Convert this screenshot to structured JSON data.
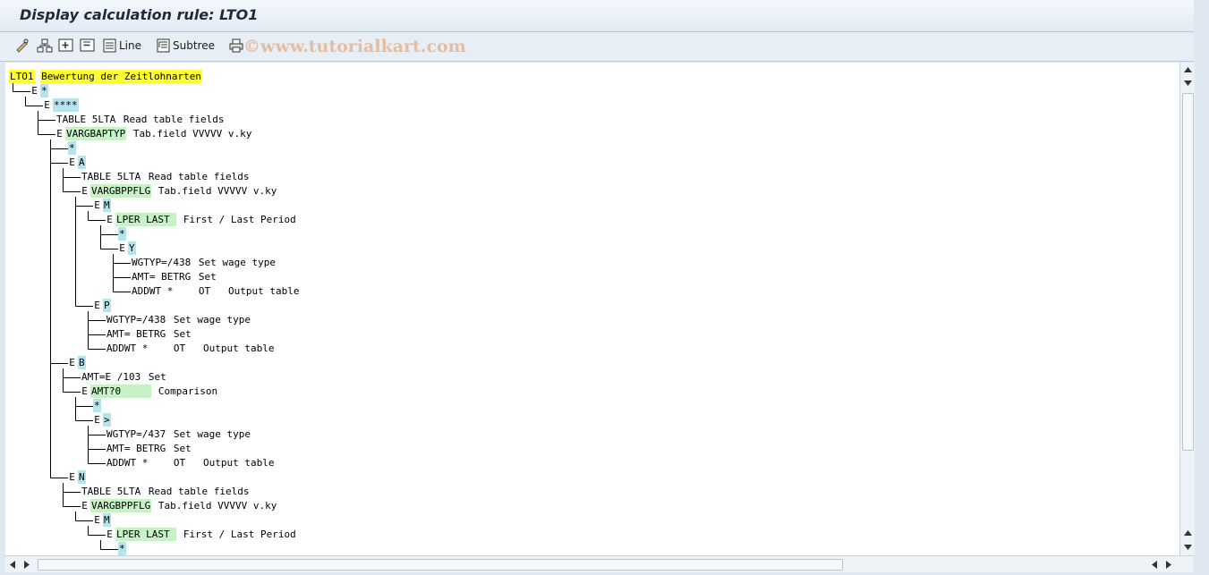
{
  "window": {
    "title": "Display calculation rule: LTO1"
  },
  "toolbar": {
    "line_label": "Line",
    "subtree_label": "Subtree",
    "watermark": "©www.tutorialkart.com"
  },
  "tree_rows": [
    {
      "depth": 0,
      "marker": "",
      "op": "LTO1",
      "op_hl": "yellow",
      "text": "Bewertung der Zeitlohnarten",
      "text_hl": "yellow",
      "elbow": false
    },
    {
      "depth": 1,
      "marker": "E",
      "op": "*",
      "op_hl": "cyan",
      "text": "",
      "text_hl": "",
      "elbow": true
    },
    {
      "depth": 2,
      "marker": "E",
      "op": "****",
      "op_hl": "cyan",
      "text": "",
      "text_hl": "",
      "elbow": true
    },
    {
      "depth": 3,
      "marker": "",
      "op": "TABLE 5LTA",
      "op_hl": "white",
      "text": "Read table fields",
      "text_hl": "",
      "elbow": false
    },
    {
      "depth": 3,
      "marker": "E",
      "op": "VARGBAPTYP",
      "op_hl": "green",
      "text": "Tab.field VVVVV v.ky",
      "text_hl": "",
      "elbow": true
    },
    {
      "depth": 4,
      "marker": "",
      "op": "*",
      "op_hl": "cyan",
      "text": "",
      "text_hl": "",
      "elbow": false
    },
    {
      "depth": 4,
      "marker": "E",
      "op": "A",
      "op_hl": "cyan",
      "text": "",
      "text_hl": "",
      "elbow": false
    },
    {
      "depth": 5,
      "marker": "",
      "op": "TABLE 5LTA",
      "op_hl": "white",
      "text": "Read table fields",
      "text_hl": "",
      "elbow": false
    },
    {
      "depth": 5,
      "marker": "E",
      "op": "VARGBPPFLG",
      "op_hl": "green",
      "text": "Tab.field VVVVV v.ky",
      "text_hl": "",
      "elbow": true
    },
    {
      "depth": 6,
      "marker": "E",
      "op": "M",
      "op_hl": "cyan",
      "text": "",
      "text_hl": "",
      "elbow": false
    },
    {
      "depth": 7,
      "marker": "E",
      "op": "LPER LAST ",
      "op_hl": "green",
      "text": "First / Last Period",
      "text_hl": "",
      "elbow": true
    },
    {
      "depth": 8,
      "marker": "",
      "op": "*",
      "op_hl": "cyan",
      "text": "",
      "text_hl": "",
      "elbow": false
    },
    {
      "depth": 8,
      "marker": "E",
      "op": "Y",
      "op_hl": "cyan",
      "text": "",
      "text_hl": "",
      "elbow": true
    },
    {
      "depth": 9,
      "marker": "",
      "op": "WGTYP=/438",
      "op_hl": "white",
      "text": "Set wage type",
      "text_hl": "",
      "elbow": false
    },
    {
      "depth": 9,
      "marker": "",
      "op": "AMT= BETRG",
      "op_hl": "white",
      "text": "Set",
      "text_hl": "",
      "elbow": false
    },
    {
      "depth": 9,
      "marker": "",
      "op": "ADDWT *   ",
      "op_hl": "white",
      "text": "OT   Output table",
      "text_hl": "",
      "elbow": true
    },
    {
      "depth": 6,
      "marker": "E",
      "op": "P",
      "op_hl": "cyan",
      "text": "",
      "text_hl": "",
      "elbow": true
    },
    {
      "depth": 7,
      "marker": "",
      "op": "WGTYP=/438",
      "op_hl": "white",
      "text": "Set wage type",
      "text_hl": "",
      "elbow": false
    },
    {
      "depth": 7,
      "marker": "",
      "op": "AMT= BETRG",
      "op_hl": "white",
      "text": "Set",
      "text_hl": "",
      "elbow": false
    },
    {
      "depth": 7,
      "marker": "",
      "op": "ADDWT *   ",
      "op_hl": "white",
      "text": "OT   Output table",
      "text_hl": "",
      "elbow": true
    },
    {
      "depth": 4,
      "marker": "E",
      "op": "B",
      "op_hl": "cyan",
      "text": "",
      "text_hl": "",
      "elbow": false
    },
    {
      "depth": 5,
      "marker": "",
      "op": "AMT=E /103",
      "op_hl": "white",
      "text": "Set",
      "text_hl": "",
      "elbow": false
    },
    {
      "depth": 5,
      "marker": "E",
      "op": "AMT?0     ",
      "op_hl": "green",
      "text": "Comparison",
      "text_hl": "",
      "elbow": true
    },
    {
      "depth": 6,
      "marker": "",
      "op": "*",
      "op_hl": "cyan",
      "text": "",
      "text_hl": "",
      "elbow": false
    },
    {
      "depth": 6,
      "marker": "E",
      "op": ">",
      "op_hl": "cyan",
      "text": "",
      "text_hl": "",
      "elbow": true
    },
    {
      "depth": 7,
      "marker": "",
      "op": "WGTYP=/437",
      "op_hl": "white",
      "text": "Set wage type",
      "text_hl": "",
      "elbow": false
    },
    {
      "depth": 7,
      "marker": "",
      "op": "AMT= BETRG",
      "op_hl": "white",
      "text": "Set",
      "text_hl": "",
      "elbow": false
    },
    {
      "depth": 7,
      "marker": "",
      "op": "ADDWT *   ",
      "op_hl": "white",
      "text": "OT   Output table",
      "text_hl": "",
      "elbow": true
    },
    {
      "depth": 4,
      "marker": "E",
      "op": "N",
      "op_hl": "cyan",
      "text": "",
      "text_hl": "",
      "elbow": true
    },
    {
      "depth": 5,
      "marker": "",
      "op": "TABLE 5LTA",
      "op_hl": "white",
      "text": "Read table fields",
      "text_hl": "",
      "elbow": false
    },
    {
      "depth": 5,
      "marker": "E",
      "op": "VARGBPPFLG",
      "op_hl": "green",
      "text": "Tab.field VVVVV v.ky",
      "text_hl": "",
      "elbow": true
    },
    {
      "depth": 6,
      "marker": "E",
      "op": "M",
      "op_hl": "cyan",
      "text": "",
      "text_hl": "",
      "elbow": true
    },
    {
      "depth": 7,
      "marker": "E",
      "op": "LPER LAST ",
      "op_hl": "green",
      "text": "First / Last Period",
      "text_hl": "",
      "elbow": true
    },
    {
      "depth": 8,
      "marker": "",
      "op": "*",
      "op_hl": "cyan",
      "text": "",
      "text_hl": "",
      "elbow": false
    }
  ],
  "colors": {
    "highlight_yellow": "#ffff33",
    "highlight_cyan": "#b5e3ee",
    "highlight_green": "#c6f2c6",
    "tree_line": "#000000"
  }
}
